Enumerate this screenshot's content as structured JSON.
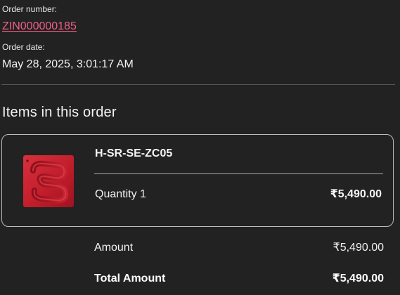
{
  "order": {
    "number_label": "Order number:",
    "number": "ZIN000000185",
    "date_label": "Order date:",
    "date": "May 28, 2025, 3:01:17 AM"
  },
  "items_section": {
    "title": "Items in this order"
  },
  "item": {
    "sku": "H-SR-SE-ZC05",
    "quantity": "Quantity 1",
    "price": "₹5,490.00",
    "thumbnail_icon": "product-thumbnail-icon"
  },
  "summary": {
    "amount_label": "Amount",
    "amount_value": "₹5,490.00",
    "total_label": "Total Amount",
    "total_value": "₹5,490.00"
  },
  "colors": {
    "background": "#222222",
    "link": "#ef5f86",
    "product_red": "#c8202f"
  }
}
